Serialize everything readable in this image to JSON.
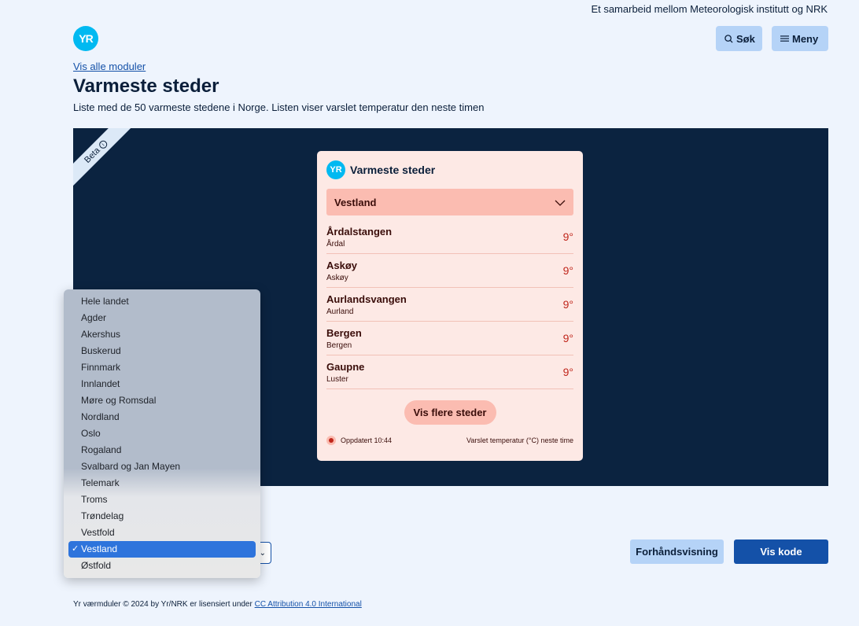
{
  "header": {
    "top_note": "Et samarbeid mellom Meteorologisk institutt og NRK",
    "logo_text": "YR",
    "search_label": "Søk",
    "menu_label": "Meny"
  },
  "page": {
    "back_link": "Vis alle moduler",
    "title": "Varmeste steder",
    "description": "Liste med de 50 varmeste stedene i Norge. Listen viser varslet temperatur den neste timen"
  },
  "preview": {
    "beta_label": "Beta",
    "widget": {
      "logo_text": "YR",
      "title": "Varmeste steder",
      "selected_region": "Vestland",
      "places": [
        {
          "name": "Årdalstangen",
          "municipality": "Årdal",
          "temp": "9°"
        },
        {
          "name": "Askøy",
          "municipality": "Askøy",
          "temp": "9°"
        },
        {
          "name": "Aurlandsvangen",
          "municipality": "Aurland",
          "temp": "9°"
        },
        {
          "name": "Bergen",
          "municipality": "Bergen",
          "temp": "9°"
        },
        {
          "name": "Gaupne",
          "municipality": "Luster",
          "temp": "9°"
        }
      ],
      "more_label": "Vis flere steder",
      "updated": "Oppdatert 10:44",
      "legend": "Varslet temperatur (°C) neste time"
    }
  },
  "dropdown": {
    "options": [
      "Hele landet",
      "Agder",
      "Akershus",
      "Buskerud",
      "Finnmark",
      "Innlandet",
      "Møre og Romsdal",
      "Nordland",
      "Oslo",
      "Rogaland",
      "Svalbard og Jan Mayen",
      "Telemark",
      "Troms",
      "Trøndelag",
      "Vestfold",
      "Vestland",
      "Østfold"
    ],
    "selected": "Vestland",
    "check": "✓"
  },
  "actions": {
    "preview_label": "Forhåndsvisning",
    "code_label": "Vis kode"
  },
  "footer": {
    "text": "Yr værmduler © 2024 by Yr/NRK er lisensiert under ",
    "link": "CC Attribution 4.0 International"
  },
  "colors": {
    "background": "#eef4fd",
    "preview_bg": "#0b2340",
    "widget_bg": "#fde9e5",
    "accent": "#fbbcb1",
    "primary": "#1451a8",
    "temp": "#c0261b"
  }
}
